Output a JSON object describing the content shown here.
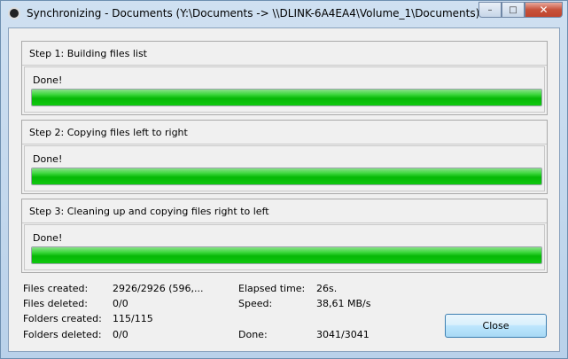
{
  "window": {
    "title": "Synchronizing - Documents (Y:\\Documents -> \\\\DLINK-6A4EA4\\Volume_1\\Documents)",
    "minimize_glyph": "–",
    "maximize_glyph": "□",
    "close_glyph": "✕"
  },
  "steps": [
    {
      "title": "Step 1: Building files list",
      "status": "Done!",
      "progress_percent": 100
    },
    {
      "title": "Step 2: Copying files left to right",
      "status": "Done!",
      "progress_percent": 100
    },
    {
      "title": "Step 3: Cleaning up and copying files right to left",
      "status": "Done!",
      "progress_percent": 100
    }
  ],
  "stats": {
    "files_created_label": "Files created:",
    "files_created_value": "2926/2926 (596,...",
    "files_deleted_label": "Files deleted:",
    "files_deleted_value": "0/0",
    "folders_created_label": "Folders created:",
    "folders_created_value": "115/115",
    "folders_deleted_label": "Folders deleted:",
    "folders_deleted_value": "0/0",
    "elapsed_label": "Elapsed time:",
    "elapsed_value": "26s.",
    "speed_label": "Speed:",
    "speed_value": "38,61 MB/s",
    "done_label": "Done:",
    "done_value": "3041/3041"
  },
  "buttons": {
    "close_label": "Close"
  },
  "colors": {
    "progress_green": "#06b806",
    "accent_blue": "#3c7fb1"
  }
}
